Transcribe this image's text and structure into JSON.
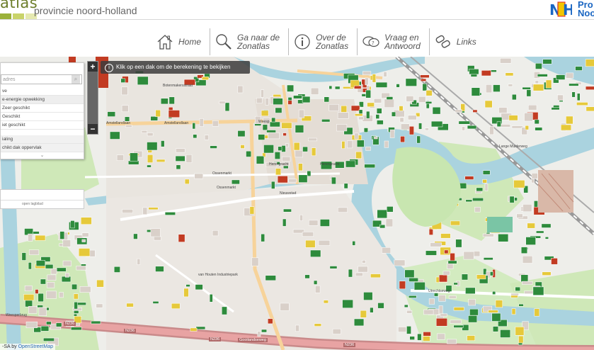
{
  "header": {
    "brand": "atlas",
    "subbrand": "provincie noord-holland",
    "logo_text_line1": "Pro",
    "logo_text_line2": "Noo",
    "colors": {
      "brand": "#6c7d2a",
      "bar1": "#9bb13a",
      "bar2": "#c9d36a",
      "bar3": "#e5e9b0",
      "logo_blue": "#1a66c2"
    }
  },
  "nav": {
    "items": [
      {
        "label": "Home",
        "icon": "house-icon"
      },
      {
        "label": "Ga naar de\nZonatlas",
        "icon": "magnifier-icon"
      },
      {
        "label": "Over de\nZonatlas",
        "icon": "info-icon"
      },
      {
        "label": "Vraag en\nAntwoord",
        "icon": "speech-bubbles-icon"
      },
      {
        "label": "Links",
        "icon": "chain-link-icon"
      }
    ]
  },
  "map": {
    "tooltip": "Klik op een dak om de berekening te bekijken",
    "zoom_in": "+",
    "zoom_out": "−",
    "attribution_prefix": "-SA by ",
    "attribution_link": "OpenStreetMap",
    "colors": {
      "water": "#aad3df",
      "green": "#c8e6b0",
      "building": "#d9d0c9",
      "very_suitable": "#2e8b3c",
      "suitable": "#e6c93a",
      "less_suitable": "#c23b22",
      "road_main": "#e8926c",
      "road_secondary": "#f7d39a"
    }
  },
  "panel": {
    "search_placeholder": "adres",
    "search_button_icon": "search-icon",
    "section_label": "ve",
    "header_row": "e-energie opwekking",
    "legend": [
      "Zeer geschikt",
      "Geschikt",
      "iet geschikt"
    ],
    "row_a": "ialing",
    "row_b": "chikt dak oppervlak",
    "handle": "⌄",
    "panel2_label": "open lagbilad"
  },
  "streets": [
    {
      "name": "Botenmakersstraat"
    },
    {
      "name": "Amstellandlaan"
    },
    {
      "name": "Amstellandlaan"
    },
    {
      "name": "Weesp"
    },
    {
      "name": "Herengracht"
    },
    {
      "name": "Herengracht"
    },
    {
      "name": "Nieuwstad"
    },
    {
      "name": "Utrechtseweg"
    },
    {
      "name": "Ossenmarkt"
    },
    {
      "name": "Ossenmarkt"
    },
    {
      "name": "van Houten Industriepark"
    },
    {
      "name": "Weesperbrug"
    },
    {
      "name": "N236"
    },
    {
      "name": "N236"
    },
    {
      "name": "N236"
    },
    {
      "name": "Gooilandseweg"
    },
    {
      "name": "N236"
    },
    {
      "name": "Lange Muiderweg"
    }
  ]
}
